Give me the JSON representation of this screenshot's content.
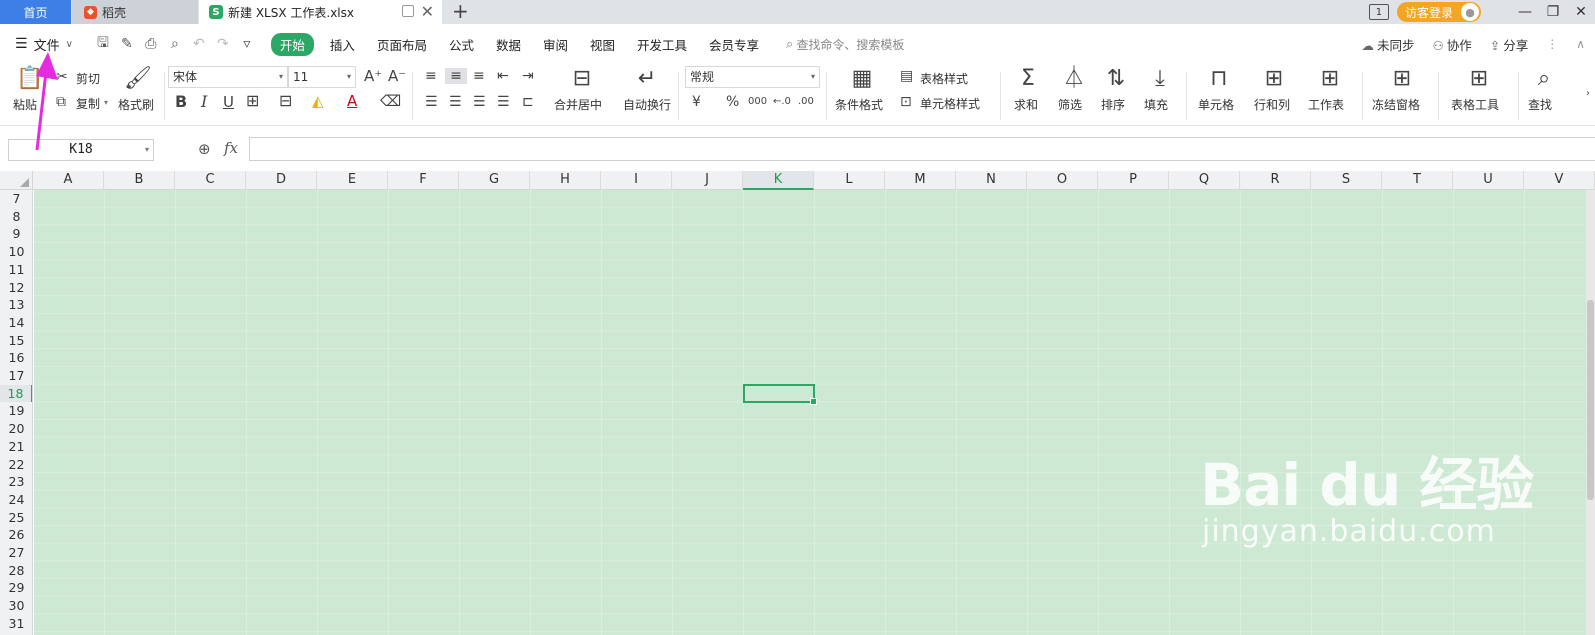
{
  "tabs": {
    "home": "首页",
    "daoke": "稻壳",
    "doc": "新建 XLSX 工作表.xlsx",
    "doc_icon": "S"
  },
  "window": {
    "login": "访客登录",
    "box_icon": "1"
  },
  "menu": {
    "file": "文件",
    "tabs": [
      "开始",
      "插入",
      "页面布局",
      "公式",
      "数据",
      "审阅",
      "视图",
      "开发工具",
      "会员专享"
    ],
    "search": "查找命令、搜索模板",
    "right": [
      "未同步",
      "协作",
      "分享"
    ]
  },
  "ribbon": {
    "paste": "粘贴",
    "cut": "剪切",
    "copy": "复制",
    "format_painter": "格式刷",
    "font_name": "宋体",
    "font_size": "11",
    "merge_center": "合并居中",
    "auto_wrap": "自动换行",
    "number_format": "常规",
    "cond_format": "条件格式",
    "table_style": "表格样式",
    "cell_style": "单元格样式",
    "sum": "求和",
    "filter": "筛选",
    "sort": "排序",
    "fill": "填充",
    "cell": "单元格",
    "row_col": "行和列",
    "worksheet": "工作表",
    "freeze": "冻结窗格",
    "table_tools": "表格工具",
    "find": "查找",
    "percent": "%",
    "thousands": "000",
    "dec_inc": "←.0",
    "dec_dec": ".00",
    "bold": "B",
    "italic": "I",
    "underline": "U",
    "font_color": "A"
  },
  "formula_bar": {
    "cell_ref": "K18",
    "fx": "fx",
    "value": ""
  },
  "grid": {
    "columns": [
      "A",
      "B",
      "C",
      "D",
      "E",
      "F",
      "G",
      "H",
      "I",
      "J",
      "K",
      "L",
      "M",
      "N",
      "O",
      "P",
      "Q",
      "R",
      "S",
      "T",
      "U",
      "V"
    ],
    "rows": [
      "7",
      "8",
      "9",
      "10",
      "11",
      "12",
      "13",
      "14",
      "15",
      "16",
      "17",
      "18",
      "19",
      "20",
      "21",
      "22",
      "23",
      "24",
      "25",
      "26",
      "27",
      "28",
      "29",
      "30",
      "31"
    ],
    "selected_column": "K",
    "selected_row": "18",
    "grid_color": "#cde8d3",
    "accent": "#2ca866"
  },
  "watermark": {
    "main": "Bai du 经验",
    "sub": "jingyan.baidu.com"
  },
  "annotation": {
    "arrow_color": "#e52be0"
  }
}
